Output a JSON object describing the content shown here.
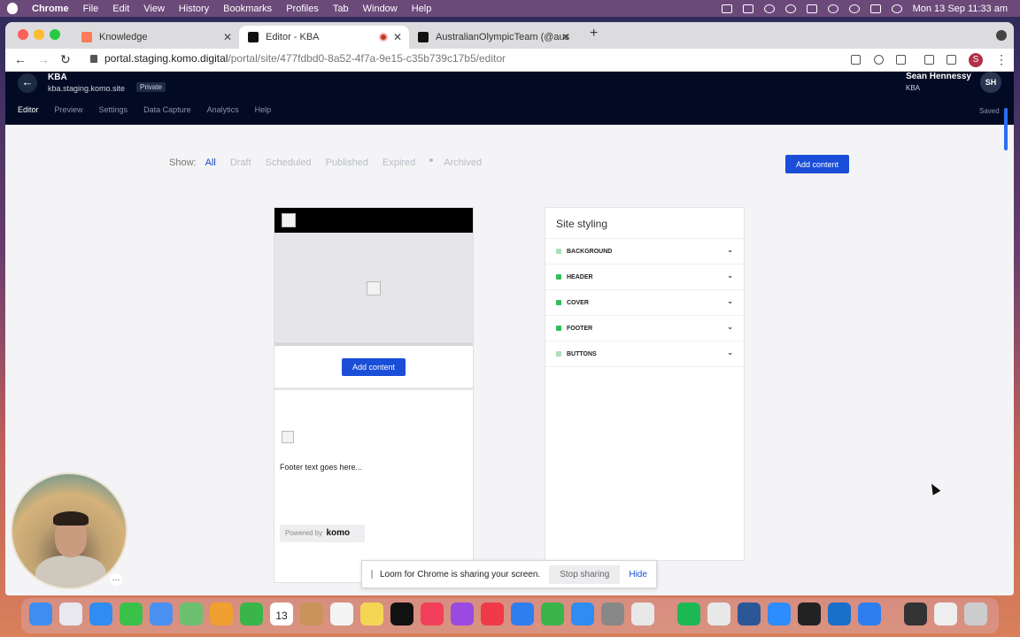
{
  "menubar": {
    "app": "Chrome",
    "items": [
      "File",
      "Edit",
      "View",
      "History",
      "Bookmarks",
      "Profiles",
      "Tab",
      "Window",
      "Help"
    ],
    "clock": "Mon 13 Sep  11:33 am"
  },
  "browser": {
    "tabs": [
      {
        "title": "Knowledge",
        "favicon_color": "#ff7a59",
        "active": false
      },
      {
        "title": "Editor - KBA",
        "favicon_color": "#111111",
        "active": true
      },
      {
        "title": "AustralianOlympicTeam (@aus",
        "favicon_color": "#111111",
        "active": false
      }
    ],
    "url_host": "portal.staging.komo.digital",
    "url_path": "/portal/site/477fdbd0-8a52-4f7a-9e15-c35b739c17b5/editor",
    "profile_initial": "S"
  },
  "app": {
    "site_name": "KBA",
    "site_url": "kba.staging.komo.site",
    "privacy_badge": "Private",
    "nav": [
      "Editor",
      "Preview",
      "Settings",
      "Data Capture",
      "Analytics",
      "Help"
    ],
    "active_nav": "Editor",
    "user_name": "Sean Hennessy",
    "user_org": "KBA",
    "user_initials": "SH",
    "save_status": "Saved"
  },
  "filters": {
    "label": "Show:",
    "options": [
      "All",
      "Draft",
      "Scheduled",
      "Published",
      "Expired",
      "Archived"
    ],
    "active": "All"
  },
  "add_content_label": "Add content",
  "preview": {
    "cta_label": "Add content",
    "footer_text": "Footer text goes here...",
    "powered_by": "Powered by",
    "brand": "komo"
  },
  "styling": {
    "title": "Site styling",
    "sections": [
      {
        "label": "BACKGROUND",
        "indicator": "light"
      },
      {
        "label": "HEADER",
        "indicator": "solid"
      },
      {
        "label": "COVER",
        "indicator": "solid"
      },
      {
        "label": "FOOTER",
        "indicator": "solid"
      },
      {
        "label": "BUTTONS",
        "indicator": "light"
      }
    ]
  },
  "loom": {
    "message": "Loom for Chrome is sharing your screen.",
    "stop_label": "Stop sharing",
    "hide_label": "Hide"
  },
  "dock": {
    "date_day": "13",
    "date_month": "SEP"
  },
  "colors": {
    "accent": "#1a4ed8",
    "header_bg": "#030b24",
    "styling_indicator": "#2fbf5a"
  }
}
